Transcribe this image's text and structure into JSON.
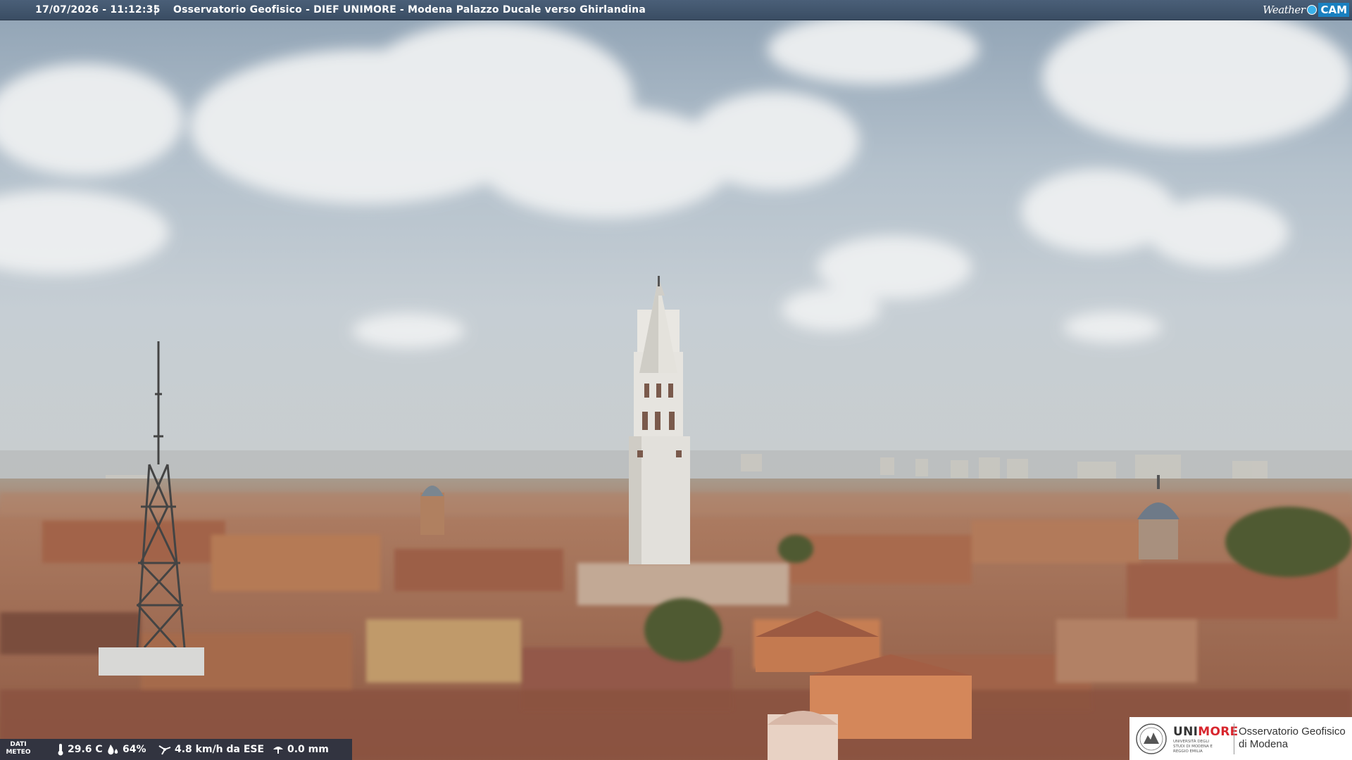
{
  "overlay": {
    "timestamp": "17/07/2026 - 11:12:35",
    "separator": "|",
    "camera_title": "Osservatorio Geofisico - DIEF UNIMORE - Modena Palazzo Ducale verso Ghirlandina",
    "brand_logo": {
      "word": "Weather",
      "cam": "CAM"
    }
  },
  "weather": {
    "label_line1": "DATI",
    "label_line2": "METEO",
    "temperature": "29.6 C",
    "humidity": "64%",
    "wind": "4.8 km/h da ESE",
    "rain": "0.0 mm",
    "icons": [
      "thermometer-icon",
      "humidity-drop-icon",
      "wind-icon",
      "rain-gauge-icon"
    ]
  },
  "org_logo": {
    "uni": "UNI",
    "more": "MORE",
    "uni_sub": "UNIVERSITÀ DEGLI STUDI DI MODENA E REGGIO EMILIA",
    "org_line1": "Osservatorio Geofisico",
    "org_line2": "di Modena"
  },
  "colors": {
    "topbar": "#3a4d63",
    "accent_red": "#d8262e",
    "sky": "#b8c4cc",
    "roofs": "#a5654a"
  }
}
